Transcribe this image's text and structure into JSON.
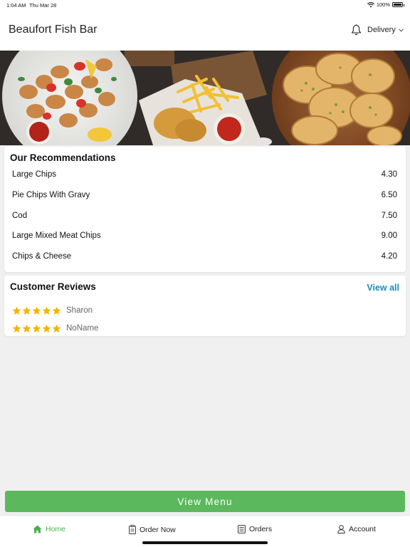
{
  "status_bar": {
    "time": "1:04 AM",
    "date": "Thu Mar 28",
    "battery": "100%",
    "battery_level": 1.0
  },
  "header": {
    "title": "Beaufort Fish Bar",
    "delivery_label": "Delivery",
    "bell_icon": "bell-icon",
    "chevron_icon": "chevron-down-icon"
  },
  "hero": {
    "description_icon": "food-banner-image"
  },
  "recommendations": {
    "title": "Our Recommendations",
    "items": [
      {
        "name": "Large Chips",
        "price": "4.30"
      },
      {
        "name": "Pie Chips With Gravy",
        "price": "6.50"
      },
      {
        "name": "Cod",
        "price": "7.50"
      },
      {
        "name": "Large Mixed Meat Chips",
        "price": "9.00"
      },
      {
        "name": "Chips & Cheese",
        "price": "4.20"
      }
    ]
  },
  "reviews": {
    "title": "Customer Reviews",
    "view_all": "View all",
    "items": [
      {
        "name": "Sharon",
        "rating": 5
      },
      {
        "name": "NoName",
        "rating": 5
      }
    ]
  },
  "cta": {
    "label": "View Menu"
  },
  "tabbar": {
    "tabs": [
      {
        "label": "Home",
        "icon": "home-icon",
        "active": true
      },
      {
        "label": "Order Now",
        "icon": "order-icon",
        "active": false
      },
      {
        "label": "Orders",
        "icon": "receipt-icon",
        "active": false
      },
      {
        "label": "Account",
        "icon": "user-icon",
        "active": false
      }
    ]
  },
  "colors": {
    "accent_green": "#5cb85c",
    "link_blue": "#1a8fc0",
    "star_gold": "#f5b301"
  }
}
